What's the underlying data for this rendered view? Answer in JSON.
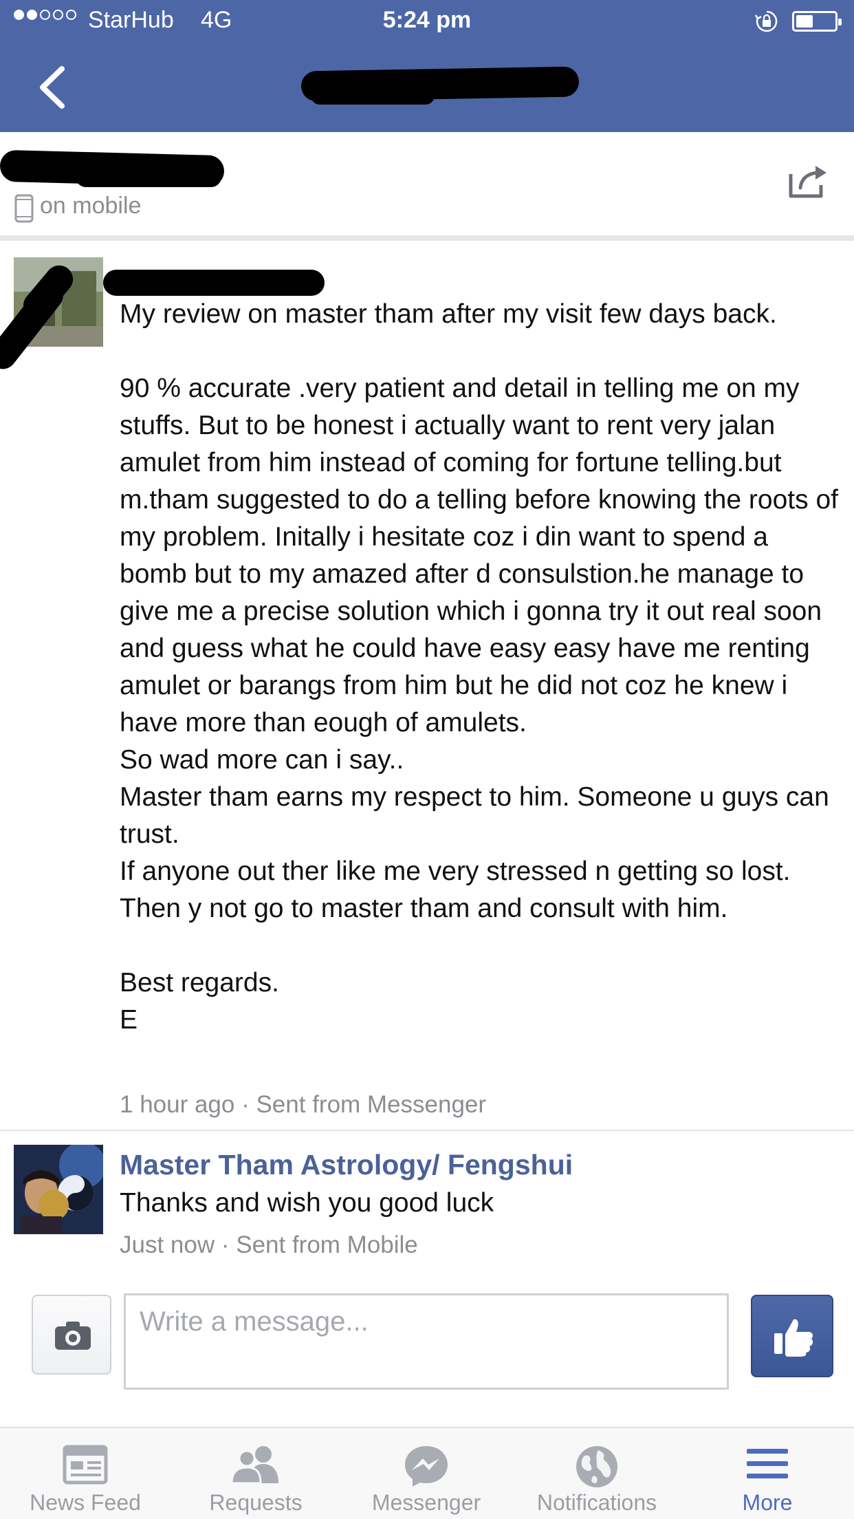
{
  "status_bar": {
    "carrier": "StarHub",
    "network": "4G",
    "time": "5:24 pm",
    "signal_bars_filled": 2,
    "signal_bars_total": 5
  },
  "nav": {
    "title": ""
  },
  "profile": {
    "name": "",
    "presence": "on mobile"
  },
  "messages": [
    {
      "sender": "",
      "text": "My review on master tham after my visit few days back.\n\n90 % accurate .very patient and detail in telling me on my stuffs. But to be honest i actually want to rent very jalan amulet from him instead of coming for fortune telling.but m.tham suggested to do a telling before knowing the roots of my problem. Initally i hesitate coz i din want to spend a bomb but to my amazed after d consulstion.he manage to give me a precise solution which i gonna try it out real soon and guess what he could have easy easy have me renting amulet or barangs from him but he did not coz he knew i have more than eough of amulets.\nSo wad more can i say..\nMaster tham earns my respect to him. Someone u guys can trust.\nIf anyone out ther like me very stressed n getting so lost. Then y not go to master tham and consult with him.\n\nBest regards.\nE",
      "meta": "1 hour ago · Sent from Messenger"
    },
    {
      "sender": "Master Tham Astrology/ Fengshui",
      "text": "Thanks and wish you good luck",
      "meta": "Just now · Sent from Mobile"
    }
  ],
  "composer": {
    "placeholder": "Write a message..."
  },
  "tabs": [
    {
      "label": "News Feed",
      "icon": "news-feed-icon"
    },
    {
      "label": "Requests",
      "icon": "friend-requests-icon"
    },
    {
      "label": "Messenger",
      "icon": "messenger-icon"
    },
    {
      "label": "Notifications",
      "icon": "globe-icon"
    },
    {
      "label": "More",
      "icon": "menu-icon",
      "active": true
    }
  ],
  "colors": {
    "header": "#4d67a6",
    "sender_name": "#4b6298",
    "meta": "#8a8d91",
    "active_tab": "#4b6cc1"
  }
}
